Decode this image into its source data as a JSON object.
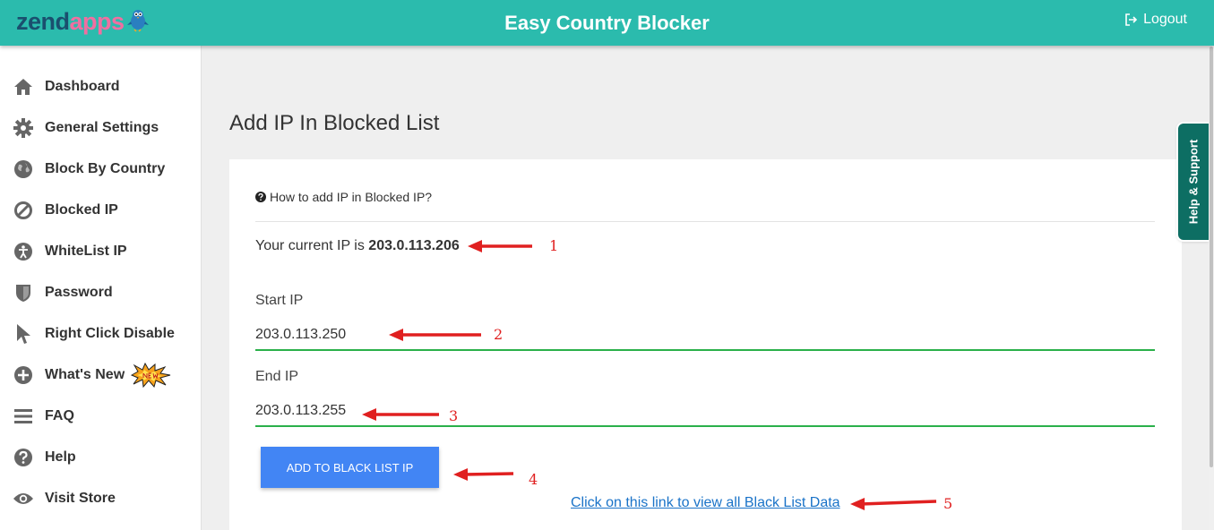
{
  "header": {
    "logo_part1": "zend",
    "logo_part2": "apps",
    "title": "Easy Country Blocker",
    "logout_label": "Logout"
  },
  "sidebar": {
    "items": [
      {
        "label": "Dashboard",
        "icon": "home-icon"
      },
      {
        "label": "General Settings",
        "icon": "gear-icon"
      },
      {
        "label": "Block By Country",
        "icon": "globe-icon"
      },
      {
        "label": "Blocked IP",
        "icon": "ban-icon"
      },
      {
        "label": "WhiteList IP",
        "icon": "accessibility-icon"
      },
      {
        "label": "Password",
        "icon": "shield-icon"
      },
      {
        "label": "Right Click Disable",
        "icon": "cursor-icon"
      },
      {
        "label": "What's New",
        "icon": "plus-circle-icon",
        "badge": "new"
      },
      {
        "label": "FAQ",
        "icon": "bars-icon"
      },
      {
        "label": "Help",
        "icon": "question-circle-icon"
      },
      {
        "label": "Visit Store",
        "icon": "eye-icon"
      }
    ]
  },
  "main": {
    "page_title": "Add IP In Blocked List",
    "howto_text": "How to add IP in Blocked IP?",
    "current_ip_prefix": "Your current IP is",
    "current_ip": "203.0.113.206",
    "start_ip_label": "Start IP",
    "start_ip_value": "203.0.113.250",
    "end_ip_label": "End IP",
    "end_ip_value": "203.0.113.255",
    "add_button": "ADD TO BLACK LIST IP",
    "blacklist_link": "Click on this link to view all Black List Data"
  },
  "annotations": [
    "1",
    "2",
    "3",
    "4",
    "5"
  ],
  "help_tab": "Help & Support",
  "colors": {
    "header": "#2bbbad",
    "button": "#4285f4",
    "input_underline": "#2ab04a",
    "annotation": "#e02020",
    "help_tab": "#0d6e63"
  }
}
